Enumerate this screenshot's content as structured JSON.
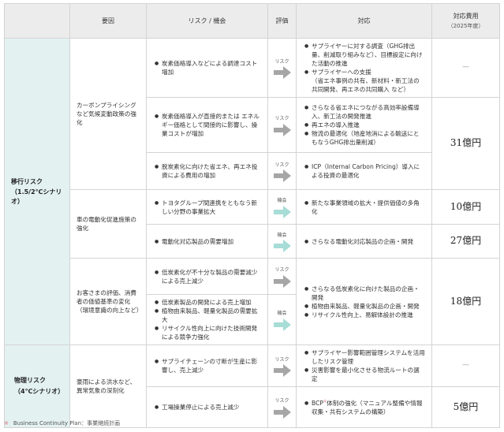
{
  "header": {
    "factor": "要因",
    "risk": "リスク / 機会",
    "eval": "評価",
    "response": "対応",
    "cost": "対応費用",
    "cost_sub": "（2025年度）"
  },
  "categories": {
    "transition_line1": "移行リスク",
    "transition_line2": "（1.5/2℃シナリオ）",
    "physical_line1": "物理リスク",
    "physical_line2": "（4℃シナリオ）"
  },
  "factors": {
    "carbon_pricing": "カーボンプライシングなど気候変動政策の強化",
    "electrification": "車の電動化促進施策の強化",
    "customer_eval": "お客さまの評価、消費者の価値基準の変化（環境意識の向上など）",
    "disaster": "豪雨による洪水など、異常気象の深刻化"
  },
  "labels": {
    "risk": "リスク",
    "opportunity": "機会"
  },
  "rows": {
    "r1_risk": [
      "炭素価格導入などによる調達コスト増加"
    ],
    "r1_resp": [
      "サプライヤーに対する調査（GHG排出量、削減取り組みなど）、目標設定に向けた活動の推進",
      "サプライヤーへの支援",
      "（省エネ事例の共有、新材料・新工法の共同開発、再エネの共同購入 など）"
    ],
    "r1_cost": "—",
    "r2_risk": [
      "炭素価格導入が直接的または エネルギー価格として間接的に影響し、操業コストが増加"
    ],
    "r2_resp": [
      "さらなる省エネにつながる高効率設備導入、新工法の開発推進",
      "再エネの導入推進",
      "物流の最適化（地産地消による輸送にともなうGHG排出量削減）"
    ],
    "r3_risk": [
      "脱炭素化に向けた省エネ、再エネ投資による費用の増加"
    ],
    "r3_resp": [
      "ICP（Internal Carbon Pricing）導入による投資の最適化"
    ],
    "r23_cost": "31億円",
    "r4_risk": [
      "トヨタグループ間連携をともなう新しい分野の事業拡大"
    ],
    "r4_resp": [
      "新たな事業領域の拡大・提供価値の多角化"
    ],
    "r4_cost": "10億円",
    "r5_risk": [
      "電動化対応製品の需要増加"
    ],
    "r5_resp": [
      "さらなる電動化対応製品の企画・開発"
    ],
    "r5_cost": "27億円",
    "r6_risk": [
      "低炭素化が不十分な製品の需要減少による売上減少"
    ],
    "r7_risk": [
      "低炭素製品の開発による売上増加",
      "植物由来製品、軽量化製品の需要拡大",
      "リサイクル性向上に向けた技術開発による競争力強化"
    ],
    "r67_resp": [
      "さらなる低炭素化に向けた製品の企画・開発",
      "植物由来製品、軽量化製品の企画・開発",
      "リサイクル性向上、易解体設計の推進"
    ],
    "r67_cost": "18億円",
    "r8_risk": [
      "サプライチェーンの寸断が生産に影響し、売上減少"
    ],
    "r8_resp": [
      "サプライヤー影響範囲管理システムを活用したリスク管理",
      "災害影響を最小化させる物流ルートの選定"
    ],
    "r8_cost": "—",
    "r9_risk": [
      "工場操業停止による売上減少"
    ],
    "r9_resp_pre": "BCP",
    "r9_resp_mark": "※",
    "r9_resp_post": "体制の強化（マニュアル整備や情報収集・共有システムの構築）",
    "r9_cost": "5億円"
  },
  "footnote": {
    "mark": "※",
    "term": "Business Continuity Plan",
    "def": "：事業継続計画"
  },
  "colors": {
    "risk_arrow": "#a6a6a6",
    "opportunity_arrow": "#a7ddd6",
    "category_bg": "#e3f1f1",
    "header_bg": "#ececec"
  }
}
